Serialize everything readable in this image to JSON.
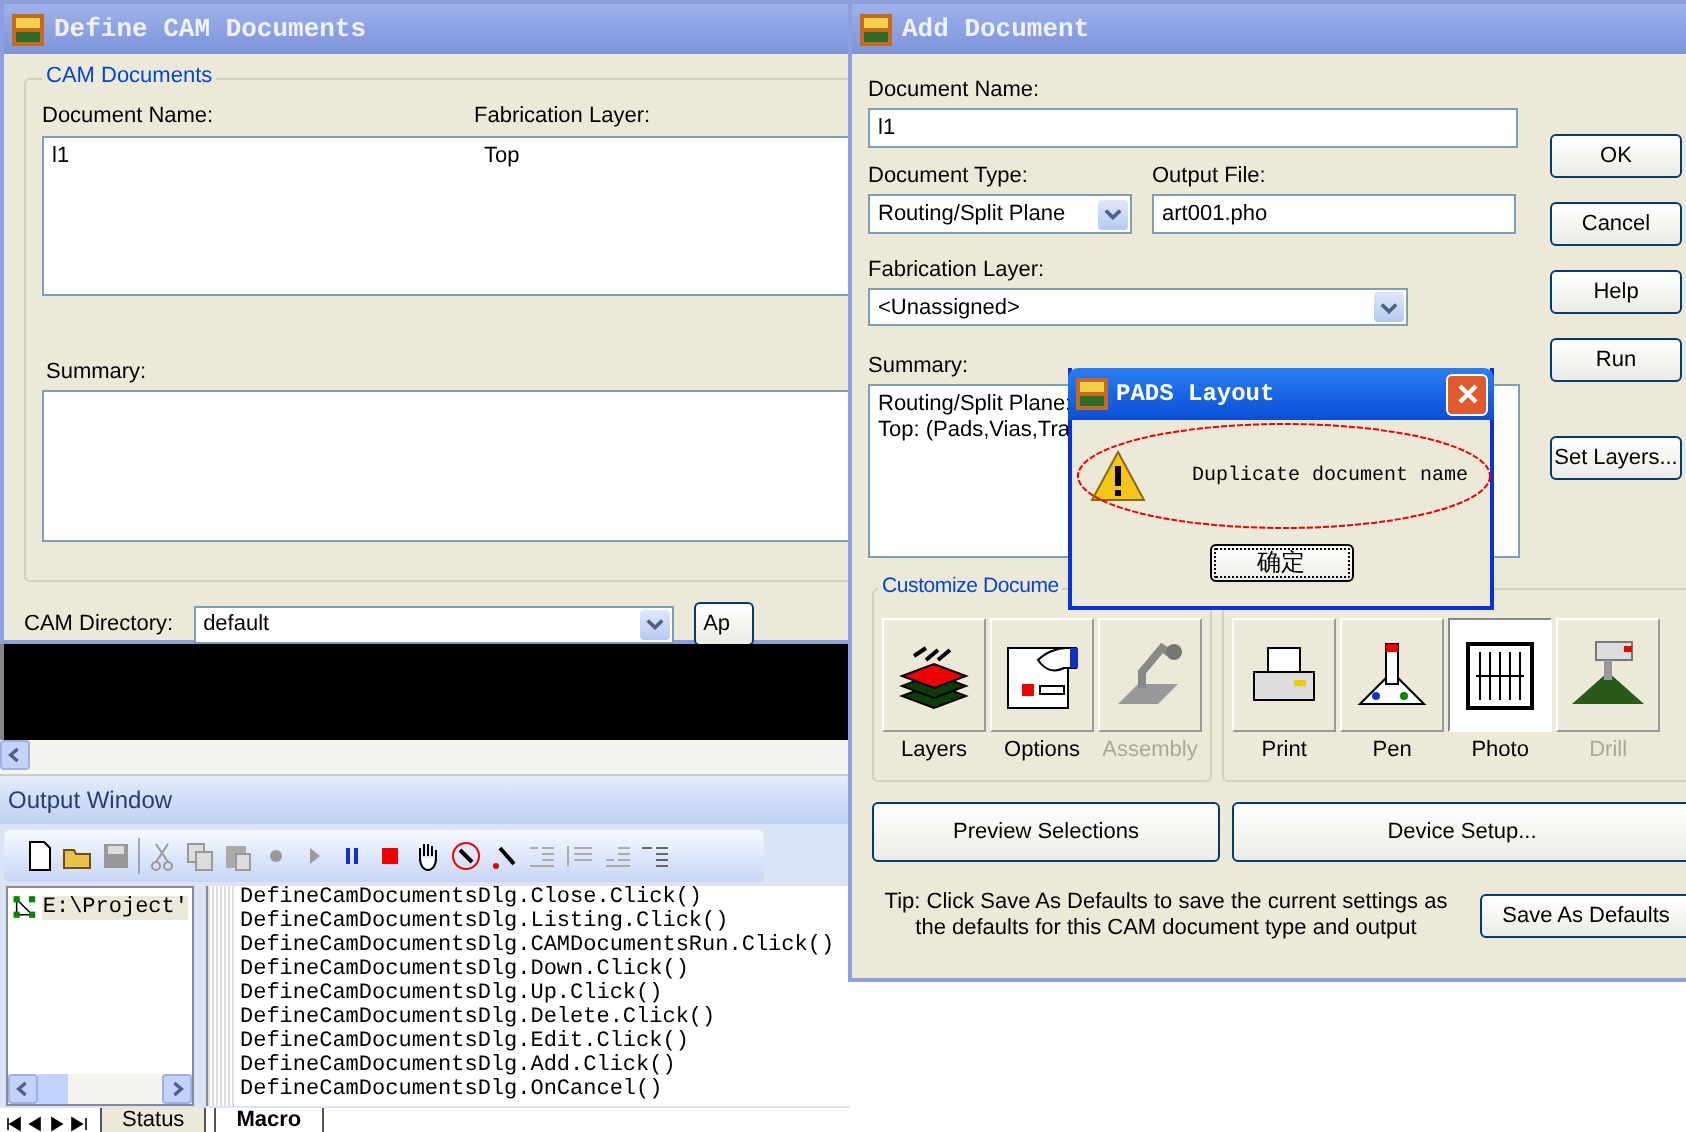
{
  "define_cam_window": {
    "title": "Define CAM Documents",
    "group_label": "CAM Documents",
    "columns": [
      "Document Name:",
      "Fabrication Layer:"
    ],
    "rows": [
      {
        "cells": [
          "l1",
          "Top"
        ]
      }
    ],
    "summary_label": "Summary:",
    "directory_label": "CAM Directory:",
    "directory_value": "default",
    "apply_button": "Ap"
  },
  "add_document_window": {
    "title": "Add Document",
    "name_label": "Document Name:",
    "name_value": "l1",
    "type_label": "Document Type:",
    "type_value": "Routing/Split Plane",
    "output_label": "Output File:",
    "output_value": "art001.pho",
    "fab_label": "Fabrication Layer:",
    "fab_value": "<Unassigned>",
    "summary_label": "Summary:",
    "summary_lines": [
      "Routing/Split Plane:",
      "Top: (Pads,Vias,Tra"
    ],
    "customize_label": "Customize Docume",
    "customize_buttons": [
      {
        "kind": "layers",
        "label": "Layers",
        "disabled": false
      },
      {
        "kind": "options",
        "label": "Options",
        "disabled": false
      },
      {
        "kind": "assembly",
        "label": "Assembly",
        "disabled": true
      }
    ],
    "output_buttons": [
      {
        "kind": "print",
        "label": "Print",
        "selected": false,
        "disabled": false
      },
      {
        "kind": "pen",
        "label": "Pen",
        "selected": false,
        "disabled": false
      },
      {
        "kind": "photo",
        "label": "Photo",
        "selected": true,
        "disabled": false
      },
      {
        "kind": "drill",
        "label": "Drill",
        "selected": false,
        "disabled": true
      }
    ],
    "preview_button": "Preview Selections",
    "device_button": "Device Setup...",
    "tip": "Tip: Click Save As Defaults to save the current settings as the defaults for this CAM document type and output",
    "save_defaults_button": "Save As Defaults",
    "side_buttons": [
      "OK",
      "Cancel",
      "Help",
      "Run",
      "Set Layers..."
    ]
  },
  "message_box": {
    "title": "PADS Layout",
    "message": "Duplicate document name",
    "button": "确定"
  },
  "output_window": {
    "title": "Output Window",
    "tree_item": "E:\\Project'",
    "lines": [
      "DefineCamDocumentsDlg.Close.Click()",
      "DefineCamDocumentsDlg.Listing.Click()",
      "DefineCamDocumentsDlg.CAMDocumentsRun.Click()",
      "DefineCamDocumentsDlg.Down.Click()",
      "DefineCamDocumentsDlg.Up.Click()",
      "DefineCamDocumentsDlg.Delete.Click()",
      "DefineCamDocumentsDlg.Edit.Click()",
      "DefineCamDocumentsDlg.Add.Click()",
      "DefineCamDocumentsDlg.OnCancel()"
    ],
    "tabs": [
      {
        "label": "Status",
        "selected": false
      },
      {
        "label": "Macro",
        "selected": true
      }
    ]
  }
}
